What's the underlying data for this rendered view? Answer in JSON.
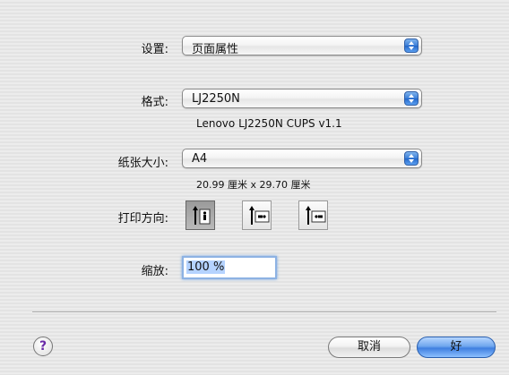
{
  "settings": {
    "label": "设置:",
    "value": "页面属性"
  },
  "format": {
    "label": "格式:",
    "value": "LJ2250N",
    "info": "Lenovo LJ2250N CUPS v1.1"
  },
  "paper": {
    "label": "纸张大小:",
    "value": "A4",
    "info": "20.99 厘米 x 29.70 厘米"
  },
  "orientation": {
    "label": "打印方向:",
    "options": [
      "portrait",
      "landscape",
      "reverse-landscape"
    ],
    "selected": "portrait"
  },
  "scale": {
    "label": "缩放:",
    "value": "100 %"
  },
  "footer": {
    "help": "?",
    "cancel": "取消",
    "ok": "好"
  },
  "colors": {
    "accent": "#3f7fe0",
    "selected_bg": "#a8a8a8"
  }
}
